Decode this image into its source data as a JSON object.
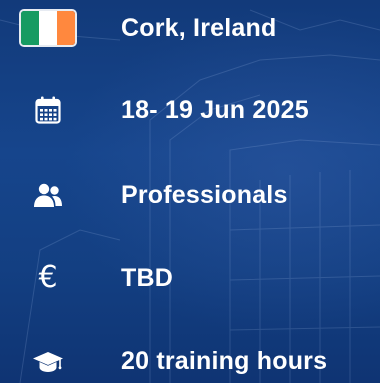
{
  "items": [
    {
      "icon": "ireland-flag-icon",
      "label": "Cork, Ireland"
    },
    {
      "icon": "calendar-icon",
      "label": "18- 19 Jun 2025"
    },
    {
      "icon": "people-icon",
      "label": "Professionals"
    },
    {
      "icon": "euro-icon",
      "label": "TBD"
    },
    {
      "icon": "graduation-cap-icon",
      "label": "20 training hours"
    }
  ],
  "colors": {
    "flag_green": "#169b62",
    "flag_white": "#ffffff",
    "flag_orange": "#ff883e",
    "background": "#16458c",
    "text": "#ffffff"
  },
  "euro_symbol": "€"
}
